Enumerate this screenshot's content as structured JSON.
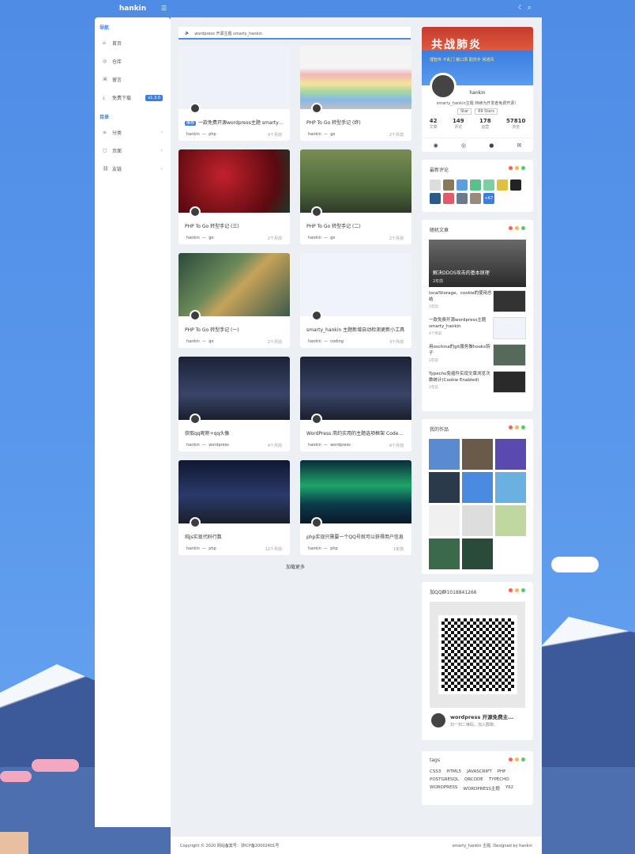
{
  "header": {
    "brand": "hankin"
  },
  "sidebar": {
    "section_nav": "导航",
    "nav_items": [
      {
        "label": "首页",
        "icon": "⌂"
      },
      {
        "label": "仓库",
        "icon": "◎"
      },
      {
        "label": "留言",
        "icon": "⌘"
      },
      {
        "label": "免费下载",
        "icon": "⤓",
        "badge": "v1.3.0"
      }
    ],
    "section_cat": "目录",
    "cat_items": [
      {
        "label": "分类",
        "icon": "≡"
      },
      {
        "label": "页面",
        "icon": "▢"
      },
      {
        "label": "友链",
        "icon": "⛓"
      }
    ]
  },
  "notice": {
    "icon": "🔈",
    "text": "wordpress 开源主题 smarty_hankin"
  },
  "posts": [
    {
      "title": "一款免费开源wordpress主题 smarty_han",
      "badge": "推荐",
      "author": "hankin",
      "cat": "php",
      "time": "4个月前",
      "bg": "#eef2f8"
    },
    {
      "title": "PHP To Go 转型手记 (终)",
      "author": "hankin",
      "cat": "go",
      "time": "2个月前",
      "bg": "linear-gradient(#f4f4f4 0 35%,#f0b7b7 45%,#f6e39a 60%,#a8d7a0 72%,#88b8e8 85%,#bfbfbf 100%)"
    },
    {
      "title": "PHP To Go 转型手记 (三)",
      "author": "hankin",
      "cat": "go",
      "time": "2个月前",
      "bg": "radial-gradient(circle at 40% 40%,#c3212c,#5a0a10 70%,#1a3a2a)"
    },
    {
      "title": "PHP To Go 转型手记 (二)",
      "author": "hankin",
      "cat": "go",
      "time": "2个月前",
      "bg": "linear-gradient(#7a8c55,#4e6a3a 60%,#2f3a2a)"
    },
    {
      "title": "PHP To Go 转型手记 (一)",
      "author": "hankin",
      "cat": "go",
      "time": "2个月前",
      "bg": "linear-gradient(135deg,#2a4a3a,#6a8a5a 40%,#c6a25a 55%,#3a5a4a)"
    },
    {
      "title": "smarty_hankin 主题新增自动检测更新小工具",
      "author": "hankin",
      "cat": "coding",
      "time": "3个月前",
      "bg": "#f0f4fa"
    },
    {
      "title": "获取qq昵称+qq头像",
      "author": "hankin",
      "cat": "wordpress",
      "time": "4个月前",
      "bg": "linear-gradient(#1c2336,#3a4468 60%,#1a1f2c)"
    },
    {
      "title": "WordPress 简约实用的主题选项框架 Codesta",
      "author": "hankin",
      "cat": "wordpress",
      "time": "4个月前",
      "bg": "linear-gradient(#1c2336,#3a4468 60%,#1a1f2c)"
    },
    {
      "title": "纯js实现代码行数",
      "author": "hankin",
      "cat": "php",
      "time": "12个月前",
      "bg": "linear-gradient(#0f1730,#2c3a6a 55%,#1a1f2c)"
    },
    {
      "title": "php实现只需要一个QQ号就可以获得用户信息",
      "author": "hankin",
      "cat": "php",
      "time": "1年前",
      "bg": "linear-gradient(#0a2a3a,#1ea56a 40%,#0a3a4a 70%,#0a1a2a)"
    }
  ],
  "loadmore": "加载更多",
  "profile": {
    "banner_title": "共战肺炎",
    "banner_sub": "理智传 不乱门 戴口罩 勤洗手 常通风",
    "name": "hankin",
    "bio": "smarty_hankin主题 持续为开发者免费开源！",
    "star": "Star",
    "stars": "69 Stars",
    "stats": [
      {
        "v": "42",
        "l": "文章"
      },
      {
        "v": "149",
        "l": "评论"
      },
      {
        "v": "178",
        "l": "运营"
      },
      {
        "v": "57810",
        "l": "浏览"
      }
    ]
  },
  "widgets": {
    "comments": {
      "title": "最新评论",
      "more": "+67"
    },
    "random": {
      "title": "随机文章",
      "feature": "解决DDOS攻击的基本原理",
      "feature_time": "2年前",
      "items": [
        {
          "t": "localStorage、cookie的使用总结",
          "time": "2年前"
        },
        {
          "t": "一款免费开源wordpress主题 smarty_hankin",
          "time": "4个月前"
        },
        {
          "t": "用oschina的git服务做hooks钩子",
          "time": "2年前"
        },
        {
          "t": "Typecho免插件实现文章浏览次数统计(Cookie Enabled)",
          "time": "2年前"
        }
      ]
    },
    "works": {
      "title": "我的作品"
    },
    "qq": {
      "title": "加QQ群1018841266",
      "name": "wordpress 开源免费主...",
      "desc": "扫一扫二维码，加入群聊。"
    },
    "tags": {
      "title": "tags",
      "list": [
        "CSS3",
        "HTML5",
        "JAVASCRIPT",
        "PHP",
        "POSTGRESQL",
        "QRCODE",
        "TYPECHO",
        "WORDPRESS",
        "WORDPRESS主题",
        "YII2"
      ]
    }
  },
  "footer": {
    "left": "Copyright © 2020 网站备案号：浙ICP备20002401号",
    "right": "smarty_hankin 主题. Designed by hankin"
  },
  "colors": {
    "accent": "#3a7ee0",
    "dot1": "#f0625e",
    "dot2": "#f7b84b",
    "dot3": "#59c56b"
  }
}
